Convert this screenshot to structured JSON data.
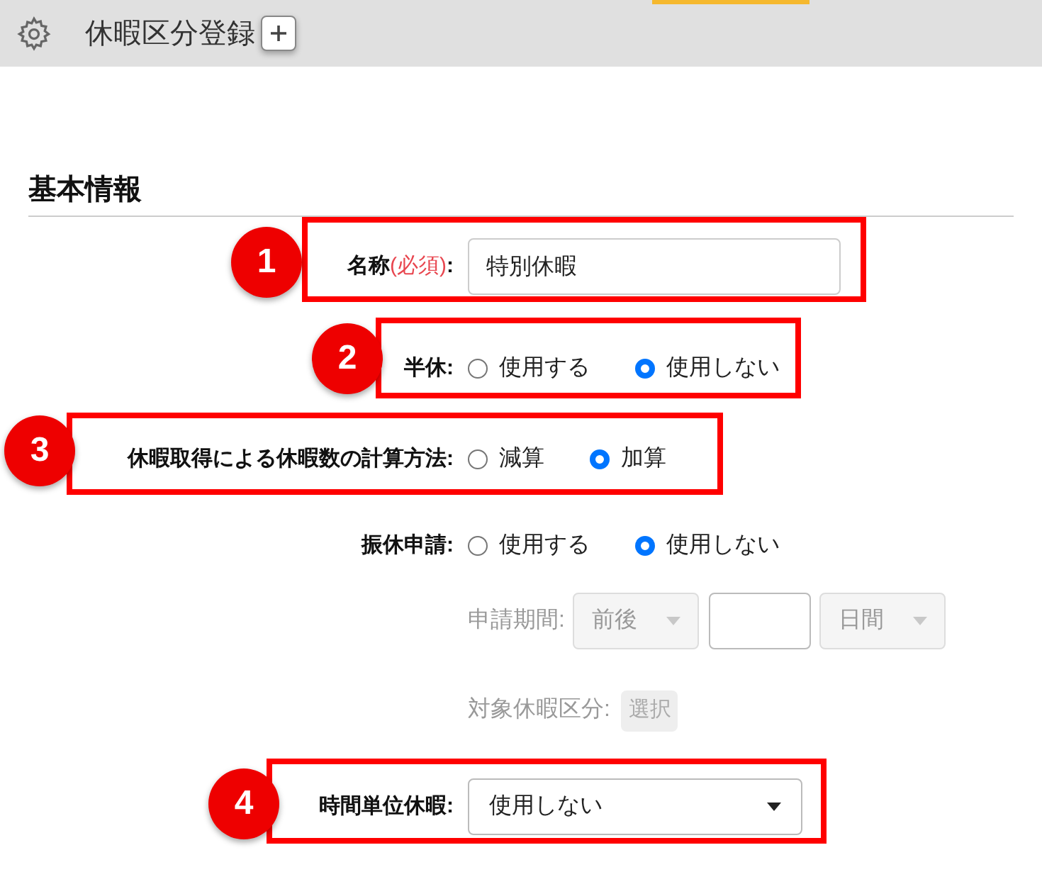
{
  "header": {
    "title": "休暇区分登録"
  },
  "section": {
    "title": "基本情報"
  },
  "fields": [
    {
      "kind": "text",
      "label": "名称",
      "required_note": "(必須)",
      "label_end": ":",
      "value": "特別休暇",
      "annotation": "1"
    },
    {
      "kind": "radio",
      "label": "半休:",
      "options": [
        {
          "label": "使用する",
          "selected": false
        },
        {
          "label": "使用しない",
          "selected": true
        }
      ],
      "annotation": "2"
    },
    {
      "kind": "radio",
      "label": "休暇取得による休暇数の計算方法:",
      "options": [
        {
          "label": "減算",
          "selected": false
        },
        {
          "label": "加算",
          "selected": true
        }
      ],
      "annotation": "3"
    },
    {
      "kind": "radio",
      "label": "振休申請:",
      "options": [
        {
          "label": "使用する",
          "selected": false
        },
        {
          "label": "使用しない",
          "selected": true
        }
      ]
    },
    {
      "kind": "period",
      "label": "申請期間:",
      "disabled": true,
      "direction": "前後",
      "unit": "日間"
    },
    {
      "kind": "picker",
      "label": "対象休暇区分:",
      "disabled": true,
      "button": "選択"
    },
    {
      "kind": "select",
      "label": "時間単位休暇:",
      "value": "使用しない",
      "annotation": "4"
    }
  ]
}
